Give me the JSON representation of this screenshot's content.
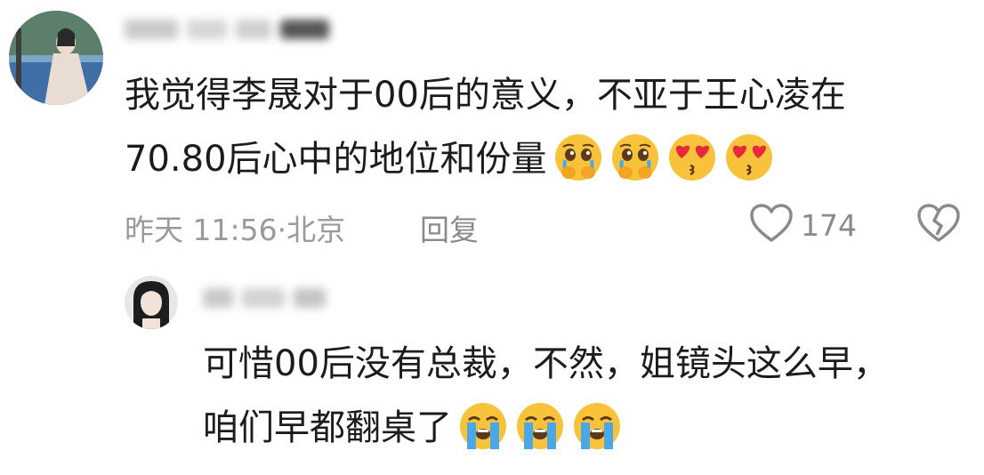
{
  "comment": {
    "text_line1": "我觉得李晟对于00后的意义，不亚于王心凌在",
    "text_line2": "70.80后心中的地位和份量",
    "emojis": [
      "pleading-tears-emoji",
      "pleading-tears-emoji",
      "heart-eyes-kiss-emoji",
      "heart-eyes-kiss-emoji"
    ],
    "time": "昨天 11:56",
    "separator": "·",
    "location": "北京",
    "reply_label": "回复",
    "like_count": "174"
  },
  "reply": {
    "text_line1": "可惜00后没有总裁，不然，姐镜头这么早，",
    "text_line2": "咱们早都翻桌了",
    "emojis": [
      "loudly-crying-emoji",
      "loudly-crying-emoji",
      "loudly-crying-emoji"
    ]
  },
  "colors": {
    "text": "#1c1c1c",
    "meta": "#9a9a9a",
    "emoji_yellow": "#f8c33a",
    "tear_blue": "#4aa8e8",
    "heart_red": "#e8283c"
  }
}
